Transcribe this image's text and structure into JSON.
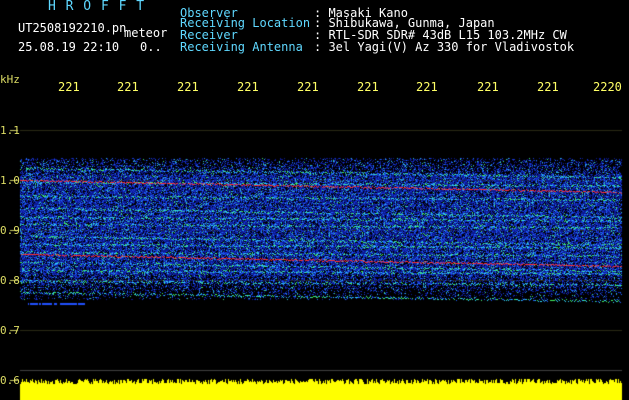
{
  "header": {
    "app_title": "H R O F F T",
    "file_name": "UT2508192210.pn",
    "file_suffix": "meteor",
    "datetime": "25.08.19 22:10",
    "counter": "0..",
    "fields": [
      {
        "label": "Observer",
        "value": ": Masaki Kano"
      },
      {
        "label": "Receiving Location",
        "value": ": Shibukawa, Gunma, Japan"
      },
      {
        "label": "Receiver",
        "value": ": RTL-SDR SDR# 43dB L15 103.2MHz CW"
      },
      {
        "label": "Receiving Antenna",
        "value": ": 3el Yagi(V) Az 330 for Vladivostok"
      }
    ]
  },
  "axes": {
    "y_unit": "kHz",
    "y_ticks": [
      "1.1",
      "1.0",
      "0.9",
      "0.8",
      "0.7",
      "0.6"
    ],
    "x_ticks": [
      "221",
      "221",
      "221",
      "221",
      "221",
      "221",
      "221",
      "221",
      "221",
      "2220"
    ]
  },
  "colors": {
    "header_label": "#5fd8ff",
    "header_value": "#ffffff",
    "tick_text": "#ffff66",
    "signal_band": "#ffff00",
    "noise_blue": "#1030c0",
    "trail_red": "#ff3030"
  }
}
